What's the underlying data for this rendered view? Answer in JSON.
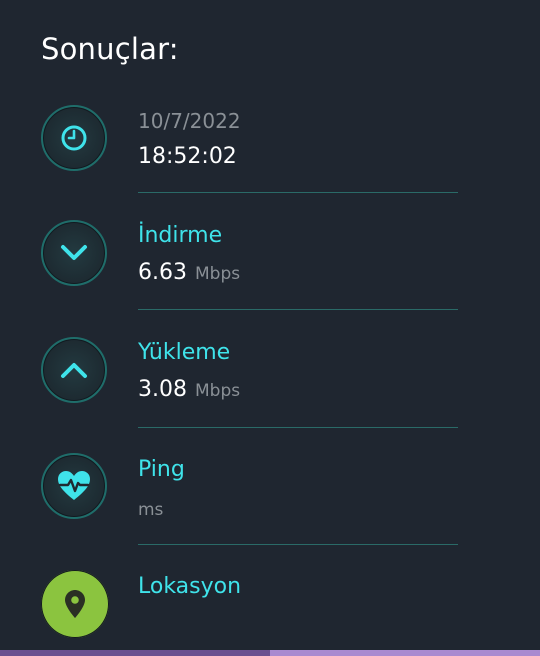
{
  "results": {
    "title": "Sonuçlar:"
  },
  "rows": {
    "datetime": {
      "date": "10/7/2022",
      "time": "18:52:02",
      "icon": "clock-icon"
    },
    "download": {
      "label": "İndirme",
      "value": "6.63",
      "unit": "Mbps",
      "icon": "chevron-down-icon"
    },
    "upload": {
      "label": "Yükleme",
      "value": "3.08",
      "unit": "Mbps",
      "icon": "chevron-up-icon"
    },
    "ping": {
      "label": "Ping",
      "value": "",
      "unit": "ms",
      "icon": "heart-pulse-icon"
    },
    "location": {
      "label": "Lokasyon",
      "icon": "location-pin-icon"
    }
  },
  "colors": {
    "background": "#1f2630",
    "accent": "#3fe3ea",
    "location_green": "#8bc43f",
    "divider": "#2a6a67"
  }
}
